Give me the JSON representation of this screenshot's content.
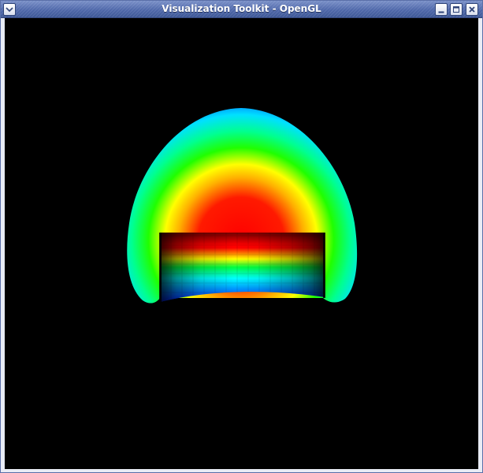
{
  "window": {
    "title": "Visualization Toolkit - OpenGL",
    "controls": {
      "menu_icon": "chevron-down-icon",
      "minimize_icon": "minimize-icon",
      "maximize_icon": "maximize-icon",
      "close_icon": "close-icon"
    }
  },
  "render": {
    "background_color": "#000000",
    "colormap": [
      "#0000ff",
      "#00ffff",
      "#00ff00",
      "#ffff00",
      "#ff0000"
    ]
  }
}
